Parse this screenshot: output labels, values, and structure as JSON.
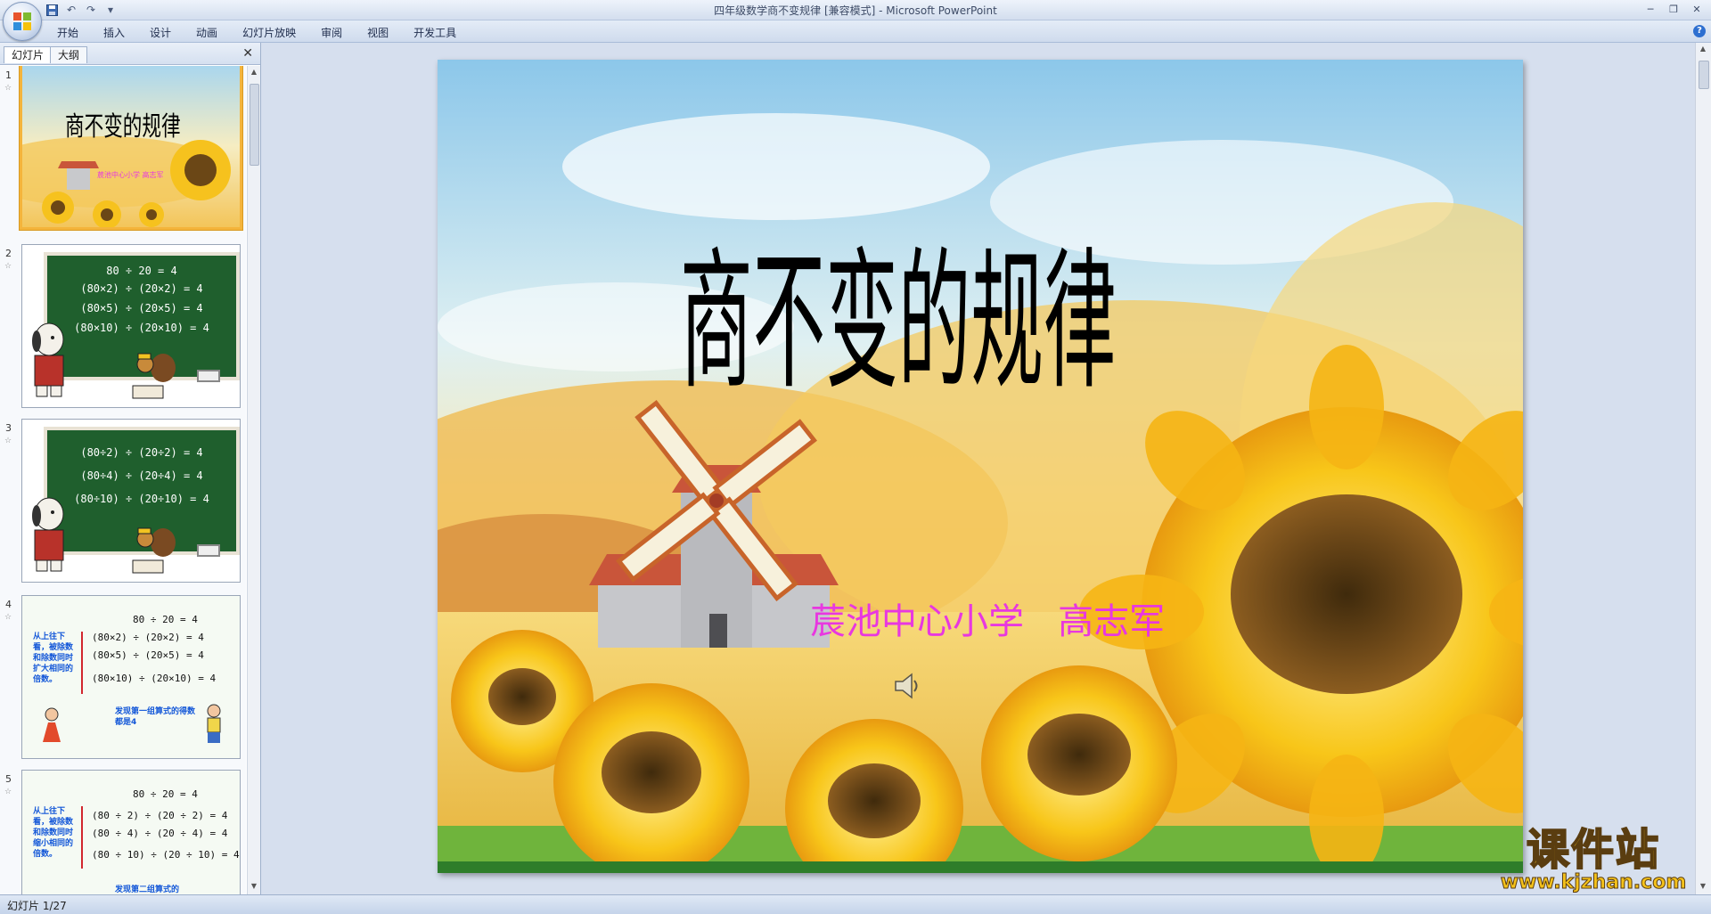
{
  "window": {
    "title": "四年级数学商不变规律 [兼容模式] - Microsoft PowerPoint"
  },
  "ribbon": {
    "tabs": [
      "开始",
      "插入",
      "设计",
      "动画",
      "幻灯片放映",
      "审阅",
      "视图",
      "开发工具"
    ]
  },
  "pane": {
    "tabs": [
      "幻灯片",
      "大纲"
    ],
    "thumbnails": [
      {
        "number": "1",
        "title": "商不变的规律",
        "subtitle": "莀池中心小学   高志军"
      },
      {
        "number": "2",
        "lines": [
          "80 ÷ 20 = 4",
          "(80×2) ÷ (20×2) = 4",
          "(80×5) ÷ (20×5) = 4",
          "(80×10) ÷ (20×10) = 4"
        ]
      },
      {
        "number": "3",
        "lines": [
          "(80÷2) ÷ (20÷2) = 4",
          "(80÷4) ÷ (20÷4) = 4",
          "(80÷10) ÷ (20÷10) = 4"
        ]
      },
      {
        "number": "4",
        "lines": [
          "80 ÷ 20 = 4",
          "(80×2) ÷ (20×2) = 4",
          "(80×5) ÷ (20×5) = 4",
          "(80×10) ÷ (20×10) = 4"
        ],
        "note": "从上往下看，被除数和除数同时扩大相同的倍数。",
        "note2": "发现第一组算式的得数都是4"
      },
      {
        "number": "5",
        "lines": [
          "80 ÷ 20 = 4",
          "(80 ÷ 2) ÷ (20 ÷ 2) = 4",
          "(80 ÷ 4) ÷ (20 ÷ 4) = 4",
          "(80 ÷ 10) ÷ (20 ÷ 10) = 4"
        ],
        "note": "从上往下看，被除数和除数同时缩小相同的倍数。",
        "note2": "发现第二组算式的"
      }
    ]
  },
  "slide": {
    "title": "商不变的规律",
    "subtitle": "莀池中心小学   高志军"
  },
  "status": {
    "text": "幻灯片 1/27"
  },
  "watermark": {
    "main": "课件站",
    "url": "www.kjzhan.com"
  },
  "colors": {
    "subtitle": "#e837e0",
    "board": "#1f5f2d",
    "selection": "#f4b43b"
  },
  "icons": [
    "office-logo-icon",
    "save-icon",
    "undo-icon",
    "redo-icon",
    "minimize-icon",
    "restore-icon",
    "close-icon",
    "help-icon",
    "speaker-icon"
  ]
}
